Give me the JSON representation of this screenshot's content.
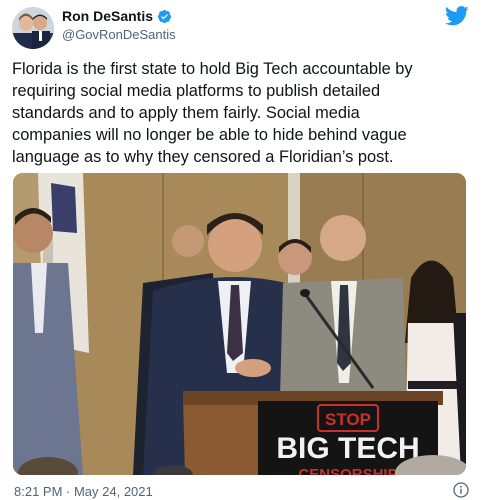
{
  "author": {
    "display_name": "Ron DeSantis",
    "handle": "@GovRonDeSantis",
    "verified": true
  },
  "tweet": {
    "text": "Florida is the first state to hold Big Tech accountable by\nrequiring social media platforms to publish detailed\nstandards and to apply them fairly. Social media\ncompanies will no longer be able to hide behind vague\nlanguage as to why they censored a Floridian’s post.",
    "timestamp": "8:21 PM · May 24, 2021"
  },
  "photo": {
    "podium_sign_line1": "STOP",
    "podium_sign_line2": "BIG TECH",
    "podium_sign_line3": "CENSORSHIP"
  },
  "icons": {
    "verified": "verified-badge-icon",
    "brand": "twitter-bird-icon",
    "info": "info-icon"
  },
  "colors": {
    "brand": "#1d9bf0",
    "text_primary": "#0f1419",
    "text_secondary": "#536471",
    "sign_red": "#c8312b"
  }
}
